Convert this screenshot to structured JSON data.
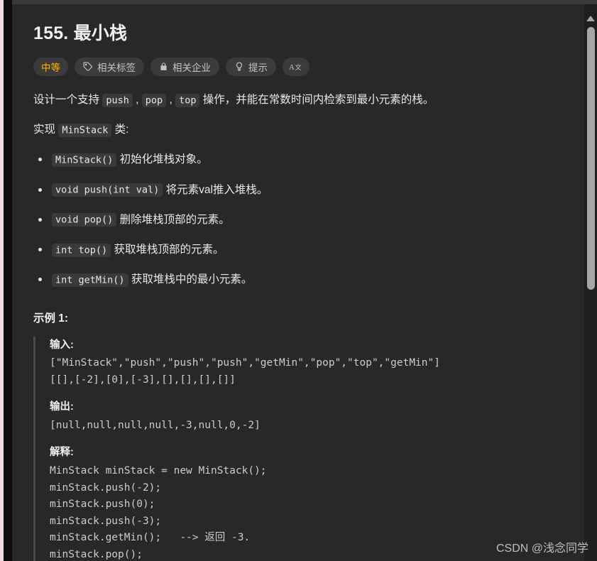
{
  "problem": {
    "title": "155. 最小栈",
    "badges": [
      {
        "label": "中等",
        "icon": "none",
        "kind": "difficulty"
      },
      {
        "label": "相关标签",
        "icon": "tag-icon",
        "kind": "normal"
      },
      {
        "label": "相关企业",
        "icon": "lock-icon",
        "kind": "normal"
      },
      {
        "label": "提示",
        "icon": "lightbulb-icon",
        "kind": "normal"
      },
      {
        "label": "",
        "icon": "translate-icon",
        "kind": "icon-only"
      }
    ],
    "description": {
      "line1_a": "设计一个支持 ",
      "code_push": "push",
      "line1_b": " , ",
      "code_pop": "pop",
      "line1_c": " , ",
      "code_top": "top",
      "line1_d": " 操作，并能在常数时间内检索到最小元素的栈。",
      "line2_a": "实现 ",
      "code_minstack": "MinStack",
      "line2_b": " 类:"
    },
    "api_list": [
      {
        "code": "MinStack()",
        "text": " 初始化堆栈对象。"
      },
      {
        "code": "void push(int val)",
        "text": " 将元素val推入堆栈。"
      },
      {
        "code": "void pop()",
        "text": " 删除堆栈顶部的元素。"
      },
      {
        "code": "int top()",
        "text": " 获取堆栈顶部的元素。"
      },
      {
        "code": "int getMin()",
        "text": " 获取堆栈中的最小元素。"
      }
    ],
    "example": {
      "title": "示例 1:",
      "input_label": "输入:",
      "input_code": "[\"MinStack\",\"push\",\"push\",\"push\",\"getMin\",\"pop\",\"top\",\"getMin\"]\n[[],[-2],[0],[-3],[],[],[],[]]",
      "output_label": "输出:",
      "output_code": "[null,null,null,null,-3,null,0,-2]",
      "explain_label": "解释:",
      "explain_code": "MinStack minStack = new MinStack();\nminStack.push(-2);\nminStack.push(0);\nminStack.push(-3);\nminStack.getMin();   --> 返回 -3.\nminStack.pop();"
    }
  },
  "scrollbar": {
    "up_arrow": "scroll-up-arrow",
    "thumb_position": "near-top"
  },
  "watermark": {
    "text": "CSDN @浅念同学"
  },
  "colors": {
    "background": "#282828",
    "text": "#e8e8e8",
    "difficulty_accent": "#ffb800",
    "code_text": "#c8ccd4",
    "inline_code_bg": "#3a3a3a",
    "badge_bg": "#3b3b3b",
    "scrollbar_thumb": "#a6a6a6"
  }
}
